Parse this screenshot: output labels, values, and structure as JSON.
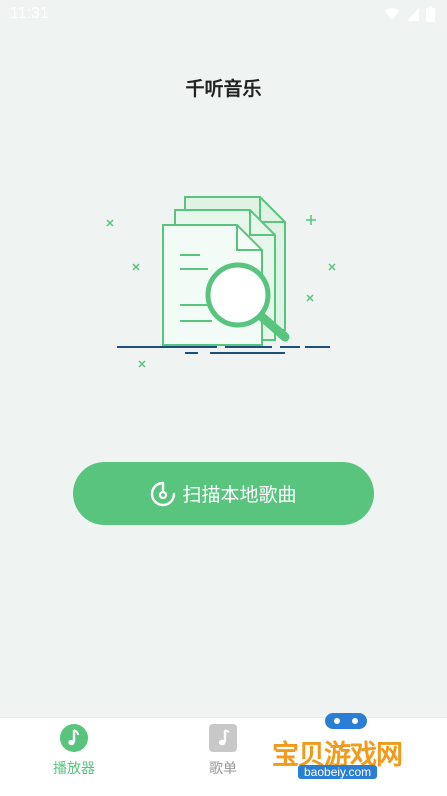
{
  "status_bar": {
    "time": "11:31"
  },
  "header": {
    "title": "千听音乐"
  },
  "scan_button": {
    "label": "扫描本地歌曲",
    "icon": "scan-clock-icon"
  },
  "bottom_nav": {
    "items": [
      {
        "label": "播放器",
        "icon": "music-note-icon",
        "active": true
      },
      {
        "label": "歌单",
        "icon": "music-note-square-icon",
        "active": false
      }
    ]
  },
  "watermark": {
    "text": "宝贝游戏网",
    "domain": "baobeiy.com"
  },
  "colors": {
    "accent": "#58c47e",
    "background": "#eff4f2",
    "inactive": "#999999"
  }
}
